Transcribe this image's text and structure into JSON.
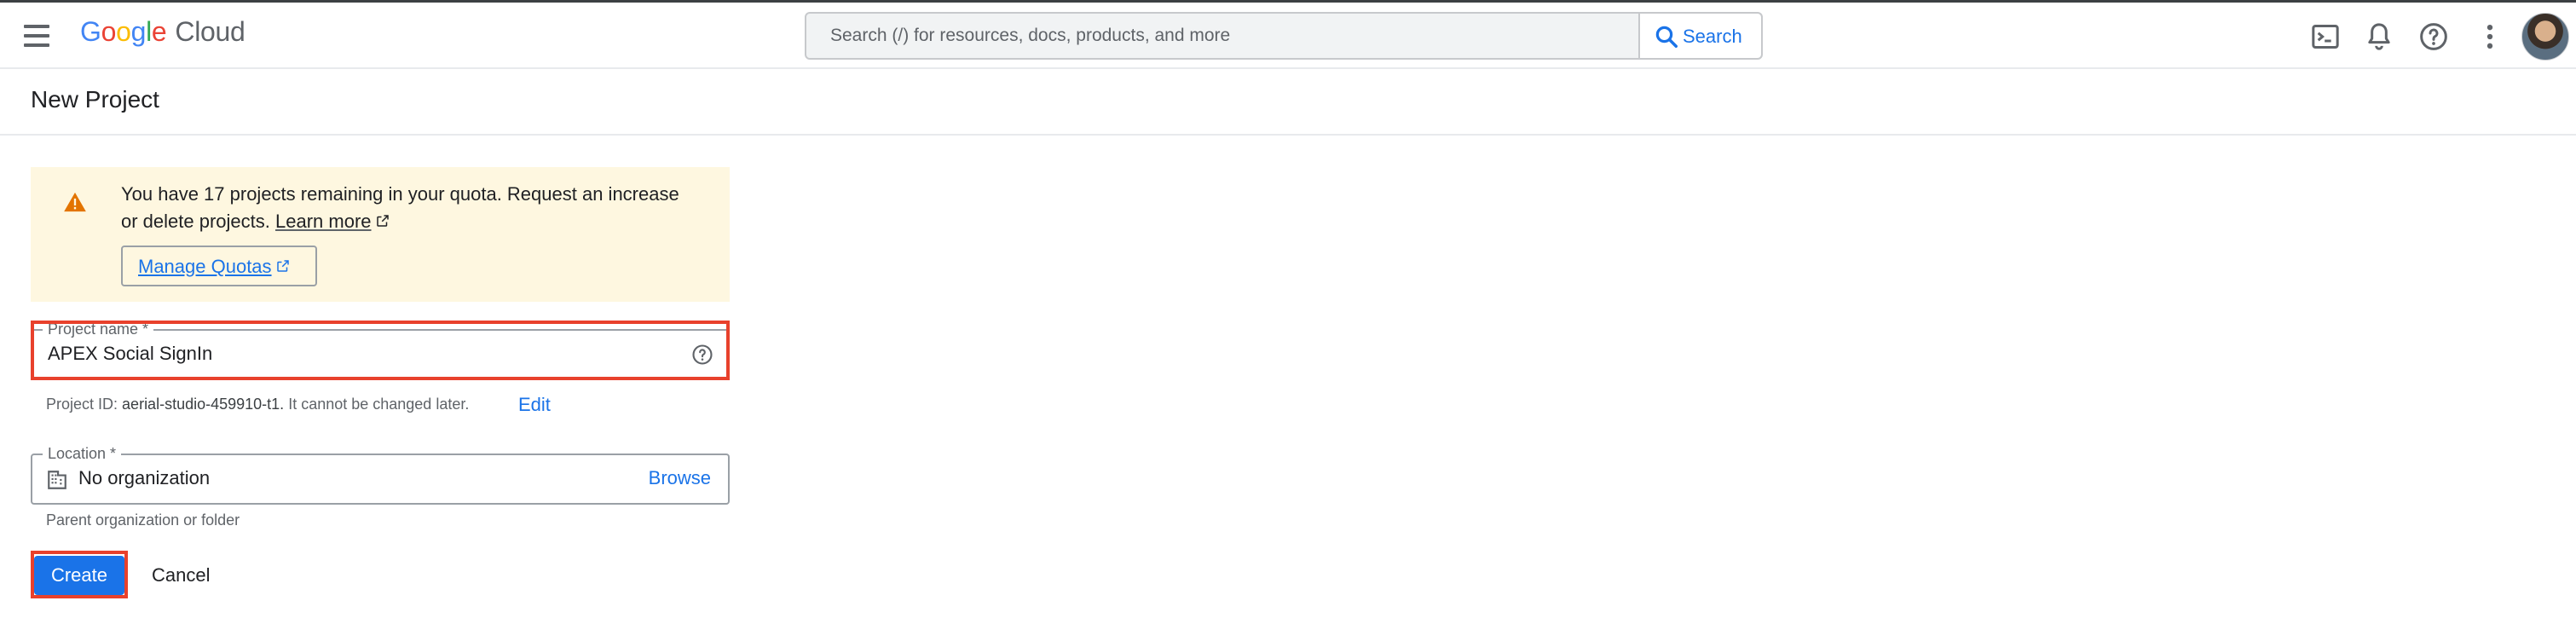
{
  "header": {
    "logo_google": "Google",
    "logo_cloud": "Cloud",
    "search_placeholder": "Search (/) for resources, docs, products, and more",
    "search_button_label": "Search",
    "icons": [
      "menu-icon",
      "cloud-shell-icon",
      "notifications-icon",
      "help-icon",
      "more-vert-icon",
      "avatar"
    ]
  },
  "page": {
    "title": "New Project"
  },
  "quota_banner": {
    "line1": "You have 17 projects remaining in your quota. Request an increase",
    "line2": "or delete projects.",
    "learn_more": "Learn more",
    "manage_quotas": "Manage Quotas",
    "background_color": "#fef7e0",
    "warning_color": "#e37400"
  },
  "project_name": {
    "label": "Project name *",
    "value": "APEX Social SignIn",
    "project_id_prefix": "Project ID:",
    "project_id": "aerial-studio-459910-t1.",
    "project_id_suffix": "It cannot be changed later.",
    "edit_label": "Edit"
  },
  "location": {
    "label": "Location *",
    "value": "No organization",
    "browse_label": "Browse",
    "hint": "Parent organization or folder"
  },
  "actions": {
    "create_label": "Create",
    "cancel_label": "Cancel"
  },
  "colors": {
    "primary": "#1a73e8",
    "highlight": "#e8412c"
  }
}
